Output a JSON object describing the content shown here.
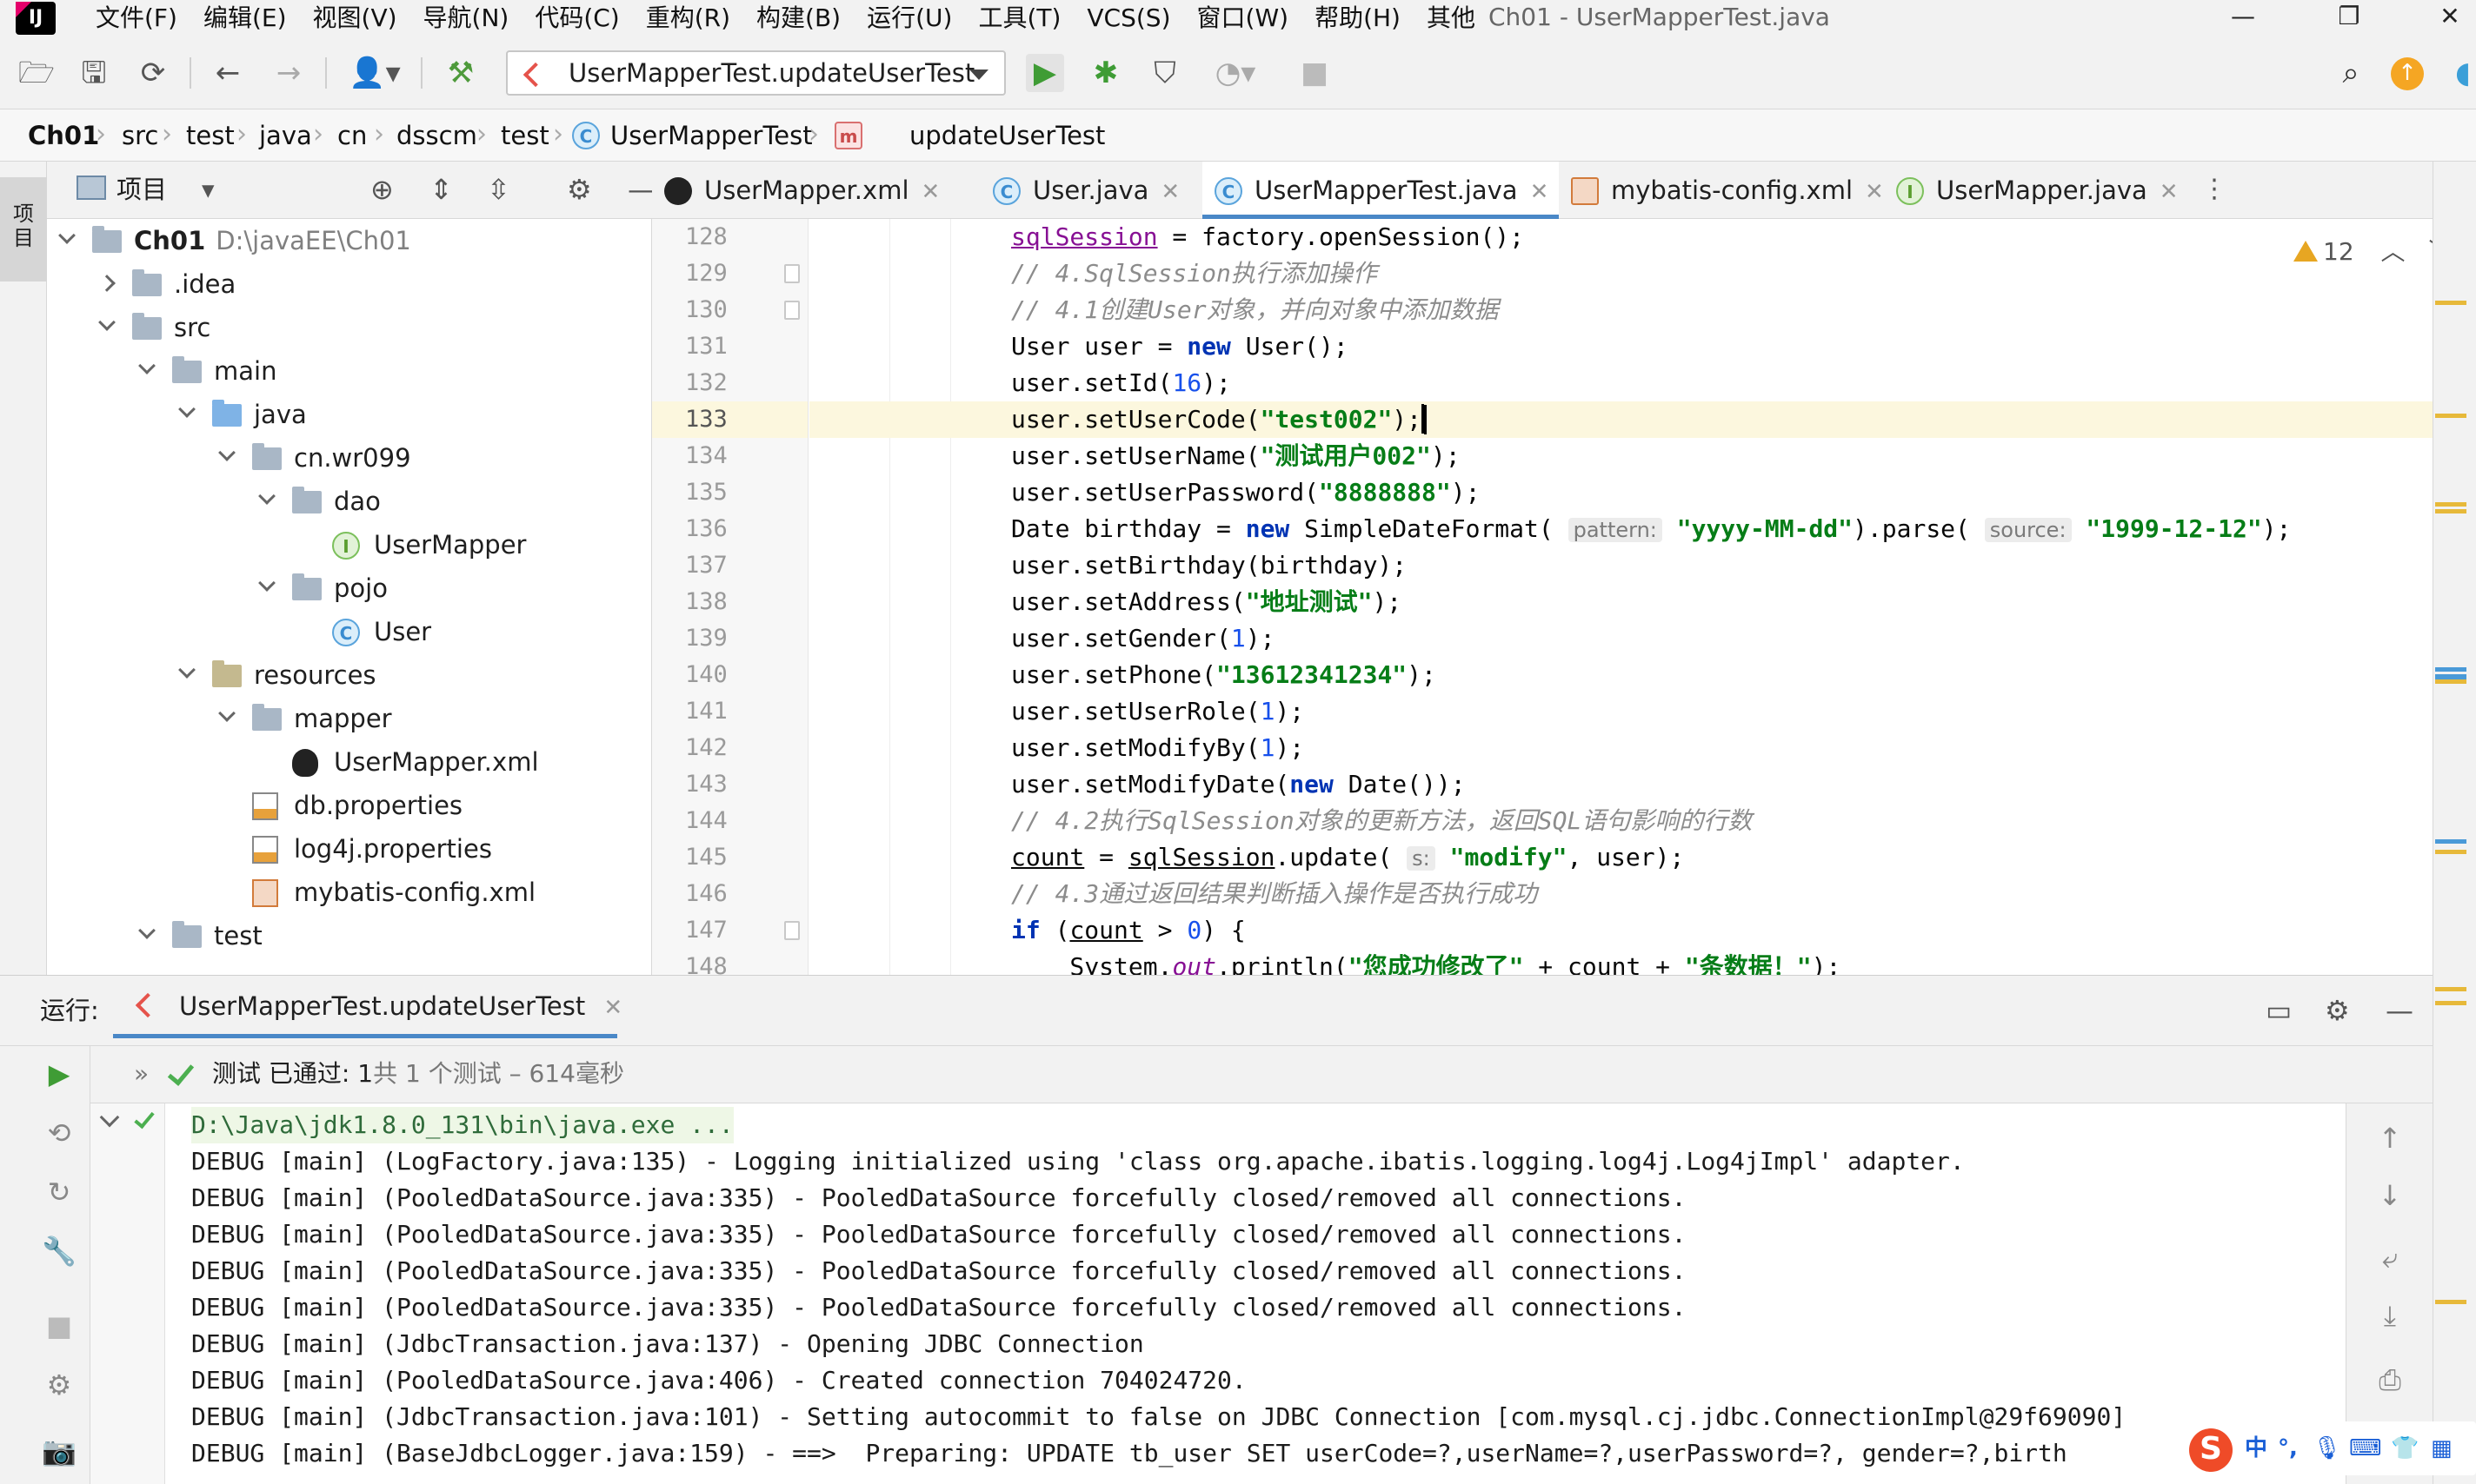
{
  "menubar": {
    "app_icon": "IJ",
    "items": [
      "文件(F)",
      "编辑(E)",
      "视图(V)",
      "导航(N)",
      "代码(C)",
      "重构(R)",
      "构建(B)",
      "运行(U)",
      "工具(T)",
      "VCS(S)",
      "窗口(W)",
      "帮助(H)",
      "其他"
    ],
    "window_title": "Ch01 - UserMapperTest.java",
    "controls": [
      "minimize-icon",
      "restore-icon",
      "close-icon"
    ]
  },
  "toolbar": {
    "run_config": "UserMapperTest.updateUserTest",
    "icons": [
      "open-folder-icon",
      "save-icon",
      "sync-icon",
      "back-arrow-icon",
      "forward-arrow-icon",
      "user-icon",
      "hammer-icon",
      "run-icon",
      "debug-icon",
      "coverage-icon",
      "profile-icon",
      "stop-icon",
      "search-icon",
      "update-icon"
    ]
  },
  "breadcrumb": [
    "Ch01",
    "src",
    "test",
    "java",
    "cn",
    "dsscm",
    "test",
    "UserMapperTest",
    "updateUserTest"
  ],
  "left_stripe": {
    "project_label": "项目"
  },
  "project_panel": {
    "title": "项目",
    "tree": [
      {
        "label": "Ch01",
        "path": "D:\\javaEE\\Ch01",
        "depth": 0,
        "state": "open",
        "type": "module"
      },
      {
        "label": ".idea",
        "depth": 1,
        "state": "closed",
        "type": "folder"
      },
      {
        "label": "src",
        "depth": 1,
        "state": "open",
        "type": "folder"
      },
      {
        "label": "main",
        "depth": 2,
        "state": "open",
        "type": "folder"
      },
      {
        "label": "java",
        "depth": 3,
        "state": "open",
        "type": "folder-blue"
      },
      {
        "label": "cn.wr099",
        "depth": 4,
        "state": "open",
        "type": "folder"
      },
      {
        "label": "dao",
        "depth": 5,
        "state": "open",
        "type": "folder"
      },
      {
        "label": "UserMapper",
        "depth": 6,
        "state": "none",
        "type": "interface"
      },
      {
        "label": "pojo",
        "depth": 5,
        "state": "open",
        "type": "folder"
      },
      {
        "label": "User",
        "depth": 6,
        "state": "none",
        "type": "class"
      },
      {
        "label": "resources",
        "depth": 3,
        "state": "open",
        "type": "folder-res"
      },
      {
        "label": "mapper",
        "depth": 4,
        "state": "open",
        "type": "folder"
      },
      {
        "label": "UserMapper.xml",
        "depth": 5,
        "state": "none",
        "type": "mybatis"
      },
      {
        "label": "db.properties",
        "depth": 4,
        "state": "none",
        "type": "props"
      },
      {
        "label": "log4j.properties",
        "depth": 4,
        "state": "none",
        "type": "props"
      },
      {
        "label": "mybatis-config.xml",
        "depth": 4,
        "state": "none",
        "type": "xml"
      },
      {
        "label": "test",
        "depth": 2,
        "state": "open",
        "type": "folder"
      }
    ]
  },
  "editor_tabs": [
    {
      "label": "UserMapper.xml",
      "icon": "mybatis",
      "active": false
    },
    {
      "label": "User.java",
      "icon": "c",
      "active": false
    },
    {
      "label": "UserMapperTest.java",
      "icon": "c",
      "active": true
    },
    {
      "label": "mybatis-config.xml",
      "icon": "xml",
      "active": false
    },
    {
      "label": "UserMapper.java",
      "icon": "i",
      "active": false
    }
  ],
  "editor": {
    "warnings": "12",
    "current_line": 133,
    "line_numbers": [
      "128",
      "129",
      "130",
      "131",
      "132",
      "133",
      "134",
      "135",
      "136",
      "137",
      "138",
      "139",
      "140",
      "141",
      "142",
      "143",
      "144",
      "145",
      "146",
      "147",
      "148"
    ]
  },
  "run_panel": {
    "label": "运行:",
    "tab": "UserMapperTest.updateUserTest",
    "status_prefix": "测试 已通过: ",
    "status_count": "1",
    "status_suffix": "共 1 个测试 – 614毫秒",
    "console": [
      "D:\\Java\\jdk1.8.0_131\\bin\\java.exe ...",
      "DEBUG [main] (LogFactory.java:135) - Logging initialized using 'class org.apache.ibatis.logging.log4j.Log4jImpl' adapter.",
      "DEBUG [main] (PooledDataSource.java:335) - PooledDataSource forcefully closed/removed all connections.",
      "DEBUG [main] (PooledDataSource.java:335) - PooledDataSource forcefully closed/removed all connections.",
      "DEBUG [main] (PooledDataSource.java:335) - PooledDataSource forcefully closed/removed all connections.",
      "DEBUG [main] (PooledDataSource.java:335) - PooledDataSource forcefully closed/removed all connections.",
      "DEBUG [main] (JdbcTransaction.java:137) - Opening JDBC Connection",
      "DEBUG [main] (PooledDataSource.java:406) - Created connection 704024720.",
      "DEBUG [main] (JdbcTransaction.java:101) - Setting autocommit to false on JDBC Connection [com.mysql.cj.jdbc.ConnectionImpl@29f69090]",
      "DEBUG [main] (BaseJdbcLogger.java:159) - ==>  Preparing: UPDATE tb_user SET userCode=?,userName=?,userPassword=?, gender=?,birth"
    ]
  },
  "ime": {
    "logo": "S",
    "mode": "中",
    "punct": "°,"
  }
}
